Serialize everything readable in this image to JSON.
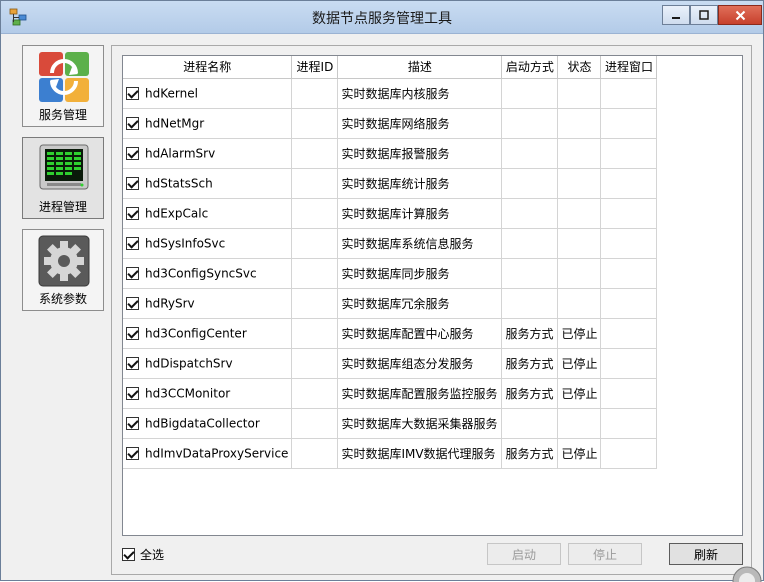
{
  "window": {
    "title": "数据节点服务管理工具"
  },
  "nav": [
    {
      "label": "服务管理"
    },
    {
      "label": "进程管理"
    },
    {
      "label": "系统参数"
    }
  ],
  "table": {
    "headers": [
      "进程名称",
      "进程ID",
      "描述",
      "启动方式",
      "状态",
      "进程窗口"
    ],
    "rows": [
      {
        "name": "hdKernel",
        "pid": "",
        "desc": "实时数据库内核服务",
        "start": "",
        "status": "",
        "win": ""
      },
      {
        "name": "hdNetMgr",
        "pid": "",
        "desc": "实时数据库网络服务",
        "start": "",
        "status": "",
        "win": ""
      },
      {
        "name": "hdAlarmSrv",
        "pid": "",
        "desc": "实时数据库报警服务",
        "start": "",
        "status": "",
        "win": ""
      },
      {
        "name": "hdStatsSch",
        "pid": "",
        "desc": "实时数据库统计服务",
        "start": "",
        "status": "",
        "win": ""
      },
      {
        "name": "hdExpCalc",
        "pid": "",
        "desc": "实时数据库计算服务",
        "start": "",
        "status": "",
        "win": ""
      },
      {
        "name": "hdSysInfoSvc",
        "pid": "",
        "desc": "实时数据库系统信息服务",
        "start": "",
        "status": "",
        "win": ""
      },
      {
        "name": "hd3ConfigSyncSvc",
        "pid": "",
        "desc": "实时数据库同步服务",
        "start": "",
        "status": "",
        "win": ""
      },
      {
        "name": "hdRySrv",
        "pid": "",
        "desc": "实时数据库冗余服务",
        "start": "",
        "status": "",
        "win": ""
      },
      {
        "name": "hd3ConfigCenter",
        "pid": "",
        "desc": "实时数据库配置中心服务",
        "start": "服务方式",
        "status": "已停止",
        "win": ""
      },
      {
        "name": "hdDispatchSrv",
        "pid": "",
        "desc": "实时数据库组态分发服务",
        "start": "服务方式",
        "status": "已停止",
        "win": ""
      },
      {
        "name": "hd3CCMonitor",
        "pid": "",
        "desc": "实时数据库配置服务监控服务",
        "start": "服务方式",
        "status": "已停止",
        "win": ""
      },
      {
        "name": "hdBigdataCollector",
        "pid": "",
        "desc": "实时数据库大数据采集器服务",
        "start": "",
        "status": "",
        "win": ""
      },
      {
        "name": "hdImvDataProxyService",
        "pid": "",
        "desc": "实时数据库IMV数据代理服务",
        "start": "服务方式",
        "status": "已停止",
        "win": ""
      }
    ]
  },
  "footer": {
    "select_all": "全选",
    "start": "启动",
    "stop": "停止",
    "refresh": "刷新"
  },
  "icons": {
    "app": "process-tree-icon",
    "service": "refresh-arrows-icon",
    "process": "monitor-chart-icon",
    "settings": "gear-icon"
  }
}
